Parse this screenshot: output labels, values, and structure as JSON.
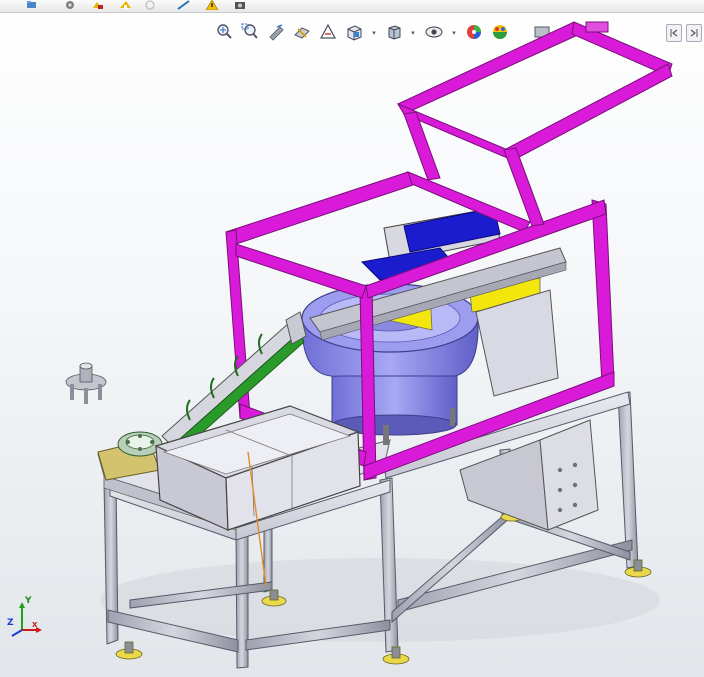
{
  "window": {
    "title": ""
  },
  "toolbar": {
    "buttons": [
      {
        "icon": "open-folder-icon"
      },
      {
        "icon": "options-gear-icon"
      },
      {
        "icon": "rebuild-icon"
      },
      {
        "icon": "edit-feature-icon"
      },
      {
        "icon": "sketch-icon"
      },
      {
        "icon": "measure-icon"
      },
      {
        "icon": "warning-icon"
      },
      {
        "icon": "camera-icon"
      }
    ]
  },
  "heads_up_view": {
    "buttons": [
      {
        "icon": "zoom-to-fit-icon"
      },
      {
        "icon": "zoom-to-area-icon"
      },
      {
        "icon": "previous-view-icon"
      },
      {
        "icon": "section-view-icon"
      },
      {
        "icon": "dynamic-annotation-icon"
      },
      {
        "icon": "view-orientation-icon"
      },
      {
        "icon": "display-style-icon"
      },
      {
        "icon": "hide-show-items-icon"
      },
      {
        "icon": "edit-appearance-icon"
      },
      {
        "icon": "apply-scene-icon"
      },
      {
        "icon": "view-settings-icon"
      }
    ]
  },
  "triad": {
    "x_label": "X",
    "y_label": "Y",
    "z_label": "Z"
  },
  "colors": {
    "frame_magenta": "#d91ad9",
    "bowl_violet": "#8e8ef0",
    "hopper_blue": "#1c1ccf",
    "chute_yellow": "#f2e60d",
    "table_steel": "#b7b9c4",
    "feet_yellow": "#e8d84a"
  }
}
